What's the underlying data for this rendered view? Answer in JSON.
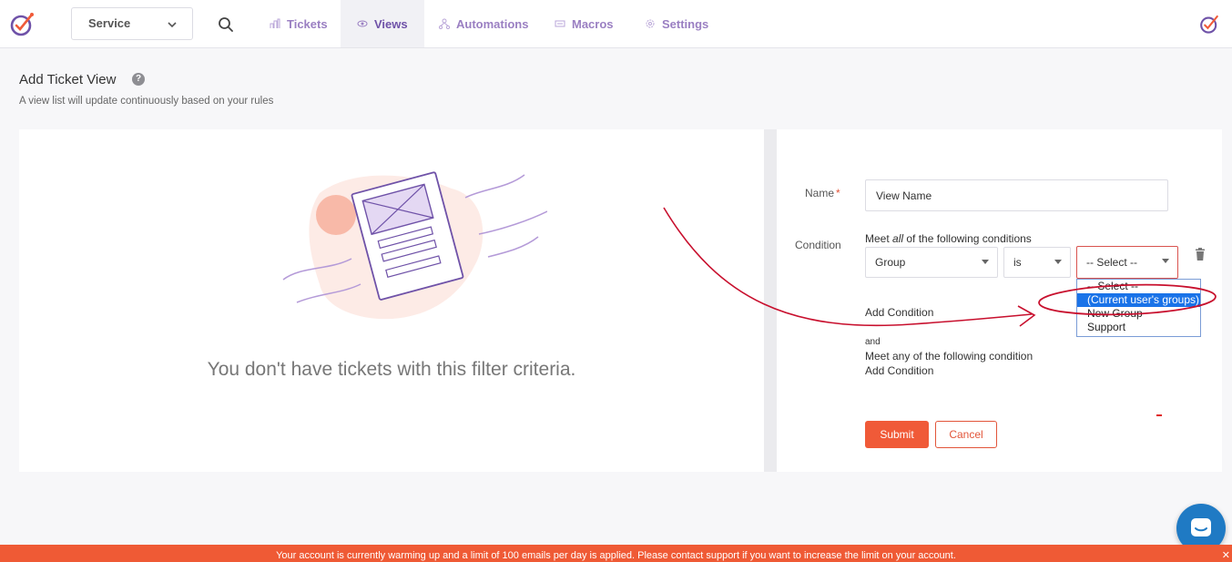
{
  "nav": {
    "service_label": "Service",
    "items": [
      {
        "label": "Tickets"
      },
      {
        "label": "Views"
      },
      {
        "label": "Automations"
      },
      {
        "label": "Macros"
      },
      {
        "label": "Settings"
      }
    ],
    "active_item": "Views"
  },
  "page": {
    "title": "Add Ticket View",
    "help_icon": "?",
    "subtitle": "A view list will update continuously based on your rules"
  },
  "empty_state": {
    "message": "You don't have tickets with this filter criteria."
  },
  "form": {
    "name_label": "Name",
    "required_mark": "*",
    "name_value": "View Name",
    "condition_label": "Condition",
    "meet_all_prefix": "Meet ",
    "meet_all_em": "all",
    "meet_all_suffix": " of the following conditions",
    "field_select": "Group",
    "operator_select": "is",
    "value_select": "-- Select --",
    "value_options": [
      "-- Select --",
      "(Current user's groups)",
      "New Group",
      "Support"
    ],
    "selected_option": "(Current user's groups)",
    "add_condition_1": "Add Condition",
    "and_label": "and",
    "meet_any_text": "Meet any of the following condition",
    "add_condition_2": "Add Condition",
    "submit_label": "Submit",
    "cancel_label": "Cancel"
  },
  "banner": {
    "text": "Your account is currently warming up and a limit of 100 emails per day is applied. Please contact support if you want to increase the limit on your account.",
    "close": "✕"
  },
  "colors": {
    "accent": "#6f52a8",
    "nav_text": "#9a7fc2",
    "submit": "#f05a38",
    "banner": "#ef5a35",
    "chat": "#1f7ac4",
    "annotation": "#c8102e"
  }
}
